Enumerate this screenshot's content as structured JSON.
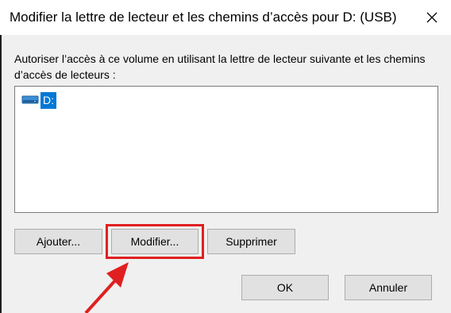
{
  "dialog": {
    "title": "Modifier la lettre de lecteur et les chemins d’accès pour D: (USB)",
    "close_icon": "close-icon"
  },
  "instructions": "Autoriser l’accès à ce volume en utilisant la lettre de lecteur suivante et les chemins d’accès de lecteurs :",
  "drive_list": {
    "items": [
      {
        "label": "D:",
        "icon": "drive-icon",
        "selected": true
      }
    ]
  },
  "buttons": {
    "add": "Ajouter...",
    "modify": "Modifier...",
    "remove": "Supprimer",
    "ok": "OK",
    "cancel": "Annuler"
  },
  "colors": {
    "selection": "#0078d7",
    "highlight": "#e02020"
  }
}
